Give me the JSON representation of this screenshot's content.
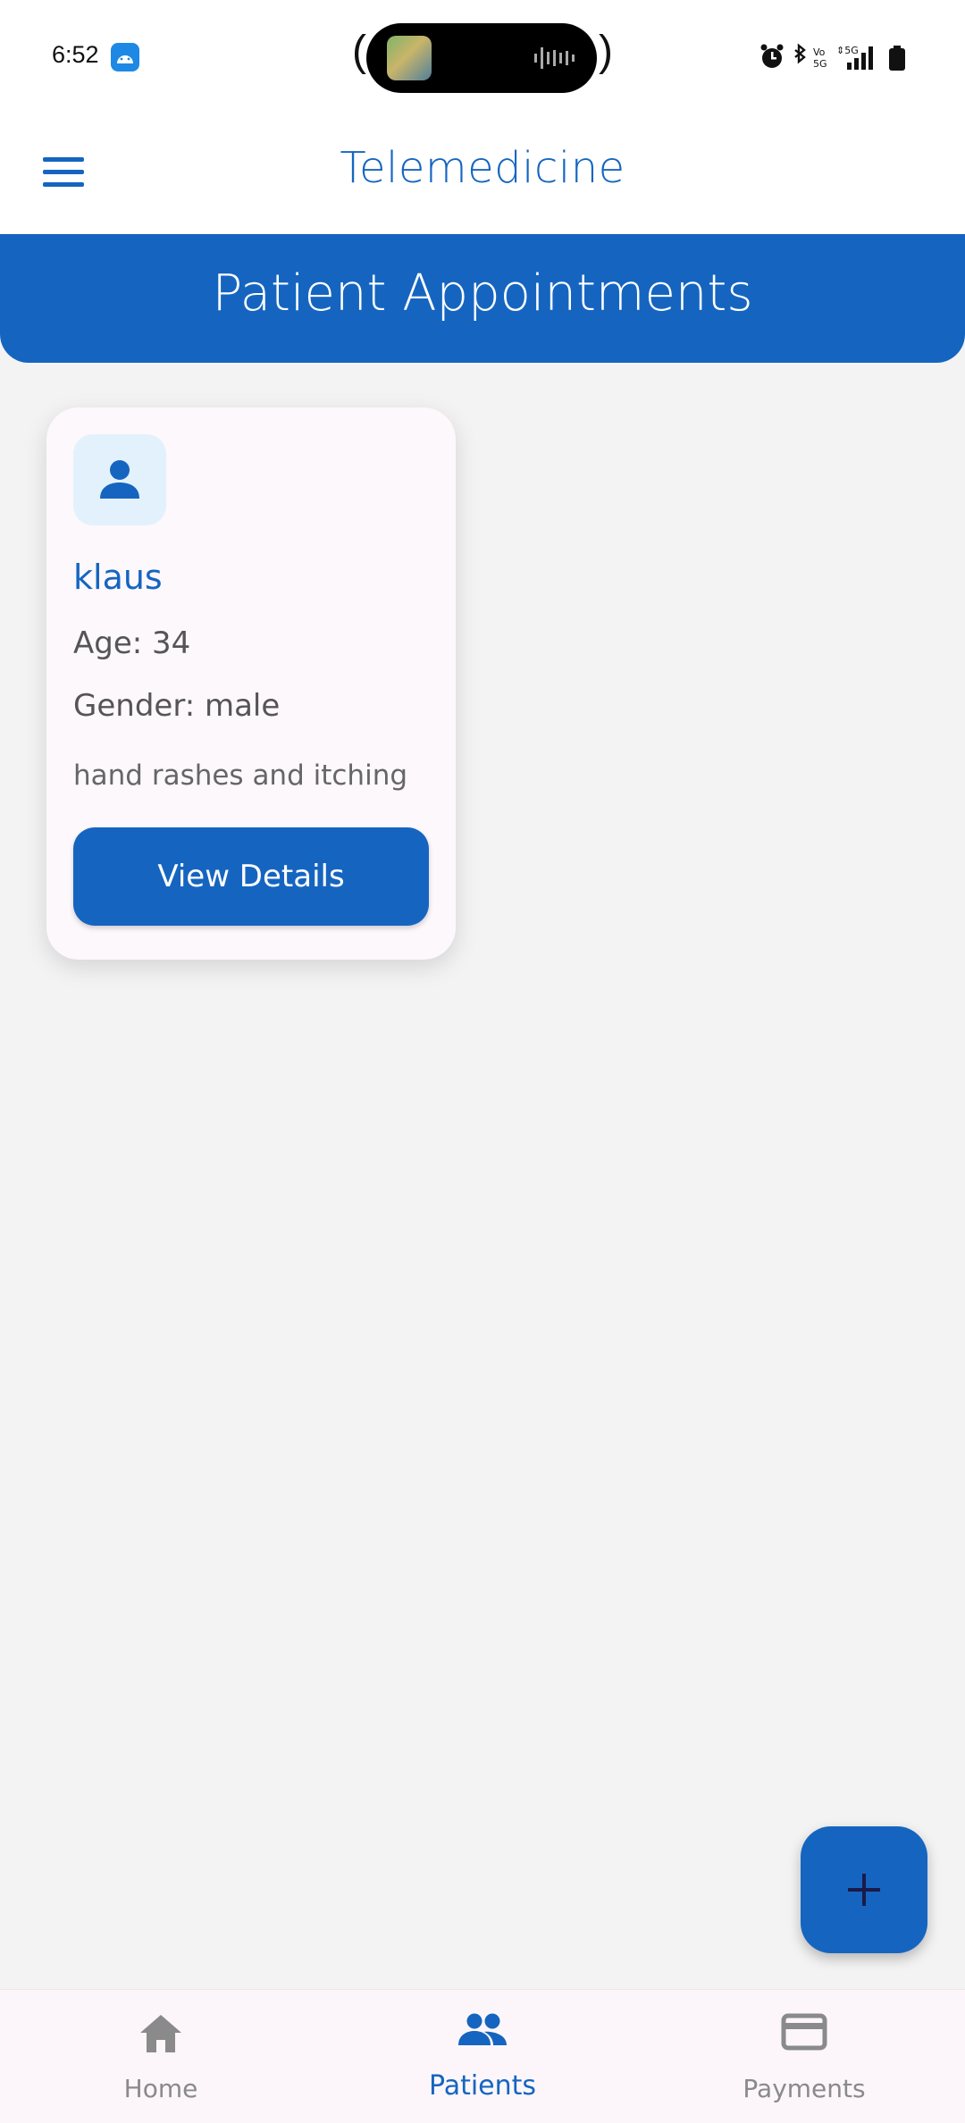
{
  "status_bar": {
    "time": "6:52"
  },
  "app_bar": {
    "title": "Telemedicine"
  },
  "banner": {
    "title": "Patient Appointments"
  },
  "patients": [
    {
      "name": "klaus",
      "age": "Age: 34",
      "gender": "Gender: male",
      "complaint": "hand rashes and itching",
      "button_label": "View Details"
    }
  ],
  "bottom_nav": {
    "items": [
      {
        "label": "Home",
        "icon": "home-icon",
        "active": false
      },
      {
        "label": "Patients",
        "icon": "people-icon",
        "active": true
      },
      {
        "label": "Payments",
        "icon": "credit-card-icon",
        "active": false
      }
    ]
  },
  "colors": {
    "primary": "#1565c0",
    "background": "#f3f3f3",
    "card": "#fdf8fc",
    "avatar_bg": "#e3f1fd",
    "inactive": "#8a8a8a"
  }
}
